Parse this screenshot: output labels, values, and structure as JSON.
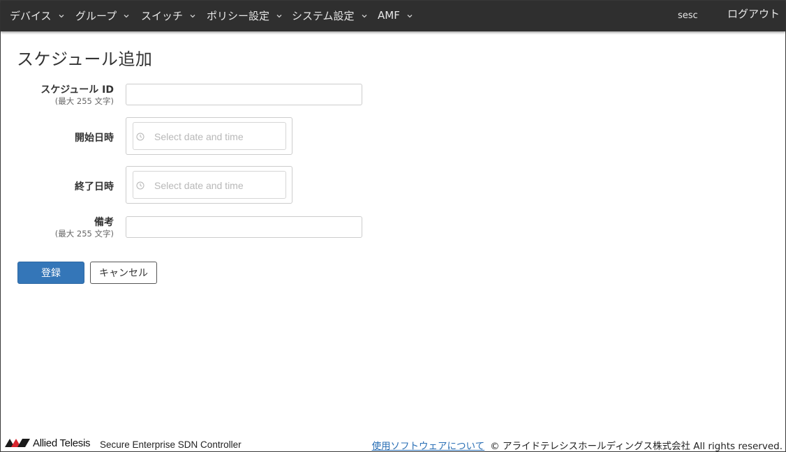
{
  "nav": {
    "items": [
      {
        "label": "デバイス"
      },
      {
        "label": "グループ"
      },
      {
        "label": "スイッチ"
      },
      {
        "label": "ポリシー設定"
      },
      {
        "label": "システム設定"
      },
      {
        "label": "AMF"
      }
    ],
    "user": "sesc",
    "logout": "ログアウト"
  },
  "page": {
    "title": "スケジュール追加"
  },
  "form": {
    "schedule_id": {
      "label": "スケジュール ID",
      "hint": "(最大 255 文字)",
      "value": ""
    },
    "start": {
      "label": "開始日時",
      "placeholder": "Select date and time"
    },
    "end": {
      "label": "終了日時",
      "placeholder": "Select date and time"
    },
    "note": {
      "label": "備考",
      "hint": "(最大 255 文字)",
      "value": ""
    },
    "submit": "登録",
    "cancel": "キャンセル"
  },
  "footer": {
    "brand": "Allied Telesis",
    "product": "Secure Enterprise SDN Controller",
    "software_link": "使用ソフトウェアについて",
    "copyright": "© アライドテレシスホールディングス株式会社 All rights reserved."
  },
  "colors": {
    "navbar": "#2f2f2f",
    "primary": "#3476b8",
    "link": "#2a6fb5",
    "logo_red": "#d7262e"
  },
  "icons": {
    "nav_dropdown": "chevron-down-icon",
    "datetime": "clock-icon"
  }
}
